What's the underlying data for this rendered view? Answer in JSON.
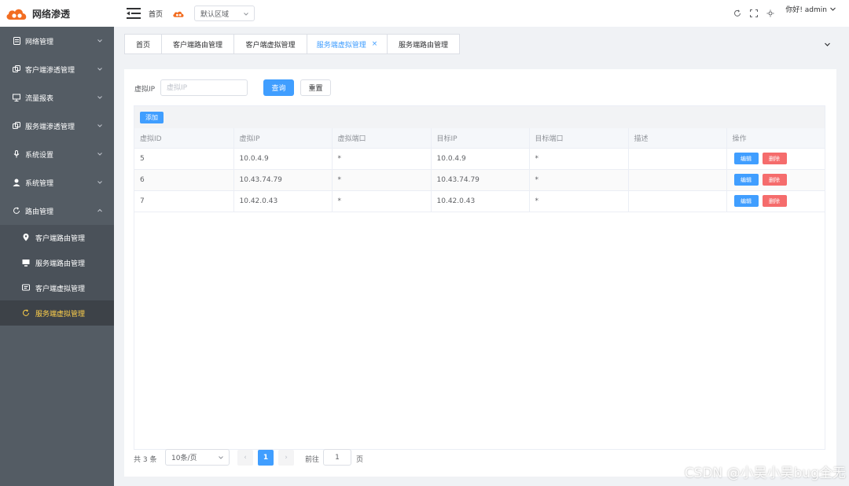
{
  "app": {
    "title": "网络渗透",
    "brand_color": "#f26d21"
  },
  "sidebar": {
    "bg": "#545c64",
    "active_color": "#ffd04b",
    "items": [
      {
        "label": "网络管理",
        "icon": "document-icon",
        "expanded": false
      },
      {
        "label": "客户端渗透管理",
        "icon": "copy-icon",
        "expanded": false
      },
      {
        "label": "流量报表",
        "icon": "presentation-icon",
        "expanded": false
      },
      {
        "label": "服务端渗透管理",
        "icon": "copy-icon",
        "expanded": false
      },
      {
        "label": "系统设置",
        "icon": "microphone-icon",
        "expanded": false
      },
      {
        "label": "系统管理",
        "icon": "user-icon",
        "expanded": false
      },
      {
        "label": "路由管理",
        "icon": "refresh-icon",
        "expanded": true
      }
    ],
    "subitems": [
      {
        "label": "客户端路由管理",
        "icon": "location-icon",
        "active": false
      },
      {
        "label": "服务端路由管理",
        "icon": "monitor-icon",
        "active": false
      },
      {
        "label": "客户端虚拟管理",
        "icon": "message-icon",
        "active": false
      },
      {
        "label": "服务端虚拟管理",
        "icon": "refresh-icon",
        "active": true
      }
    ]
  },
  "header": {
    "breadcrumb": "首页",
    "region_select": "默认区域",
    "user_greeting": "你好! admin"
  },
  "tabs": [
    {
      "label": "首页",
      "active": false,
      "closable": false
    },
    {
      "label": "客户端路由管理",
      "active": false,
      "closable": false
    },
    {
      "label": "客户端虚拟管理",
      "active": false,
      "closable": false
    },
    {
      "label": "服务端虚拟管理",
      "active": true,
      "closable": true,
      "close_symbol": "×"
    },
    {
      "label": "服务端路由管理",
      "active": false,
      "closable": false
    }
  ],
  "query": {
    "label": "虚拟IP",
    "placeholder": "虚拟IP",
    "value": "",
    "search_label": "查询",
    "reset_label": "重置"
  },
  "table": {
    "add_label": "添加",
    "columns": [
      "虚拟ID",
      "虚拟IP",
      "虚拟端口",
      "目标IP",
      "目标端口",
      "描述",
      "操作"
    ],
    "rows": [
      [
        "5",
        "10.0.4.9",
        "*",
        "10.0.4.9",
        "*",
        ""
      ],
      [
        "6",
        "10.43.74.79",
        "*",
        "10.43.74.79",
        "*",
        ""
      ],
      [
        "7",
        "10.42.0.43",
        "*",
        "10.42.0.43",
        "*",
        ""
      ]
    ],
    "edit_label": "编辑",
    "delete_label": "删除"
  },
  "pagination": {
    "total": "共 3 条",
    "page_size": "10条/页",
    "prev": "‹",
    "next": "›",
    "current": "1",
    "goto_label": "前往",
    "goto_value": "1",
    "page_suffix": "页"
  },
  "watermark": "CSDN @小吴小吴bug全无"
}
